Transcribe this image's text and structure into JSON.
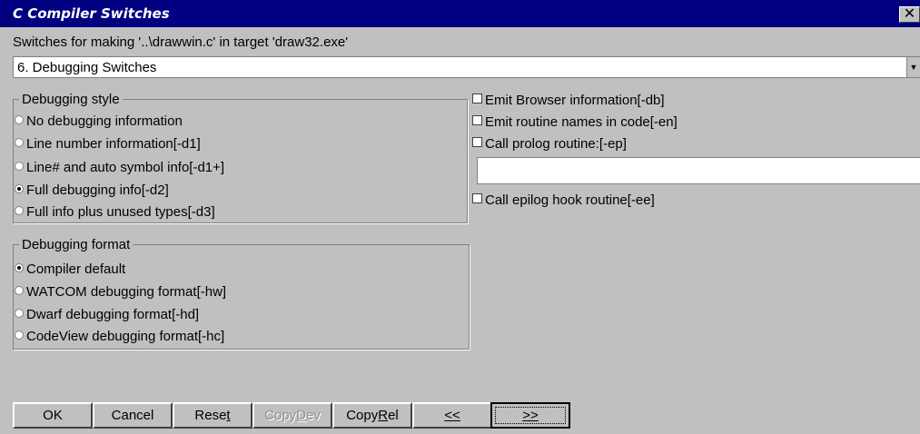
{
  "window": {
    "title": "C Compiler Switches",
    "close_glyph": "✕"
  },
  "subtitle": "Switches for making '..\\drawwin.c' in target 'draw32.exe'",
  "category_select": {
    "selected": "6. Debugging Switches",
    "arrow_icon": "dropdown-arrow"
  },
  "debugging_style": {
    "legend": "Debugging style",
    "options": [
      {
        "label": "No debugging information",
        "selected": false
      },
      {
        "label": "Line number information[-d1]",
        "selected": false
      },
      {
        "label": "Line# and auto symbol info[-d1+]",
        "selected": false
      },
      {
        "label": "Full debugging info[-d2]",
        "selected": true
      },
      {
        "label": "Full info plus unused types[-d3]",
        "selected": false
      }
    ]
  },
  "debugging_format": {
    "legend": "Debugging format",
    "options": [
      {
        "label": "Compiler default",
        "selected": true
      },
      {
        "label": "WATCOM debugging format[-hw]",
        "selected": false
      },
      {
        "label": "Dwarf debugging format[-hd]",
        "selected": false
      },
      {
        "label": "CodeView debugging format[-hc]",
        "selected": false
      }
    ]
  },
  "checkboxes": [
    {
      "label": "Emit Browser information[-db]",
      "checked": false
    },
    {
      "label": "Emit routine names in code[-en]",
      "checked": false
    },
    {
      "label": "Call prolog routine:[-ep]",
      "checked": false
    },
    {
      "label": "Call epilog hook routine[-ee]",
      "checked": false
    }
  ],
  "prolog_input": {
    "value": ""
  },
  "buttons": {
    "ok": "OK",
    "cancel": "Cancel",
    "reset_pre": "Rese",
    "reset_ul": "t",
    "copydev_pre": "Copy",
    "copydev_ul": "D",
    "copydev_post": "ev",
    "copyrel_pre": "Copy",
    "copyrel_ul": "R",
    "copyrel_post": "el",
    "prev": "<<",
    "next": ">>"
  }
}
